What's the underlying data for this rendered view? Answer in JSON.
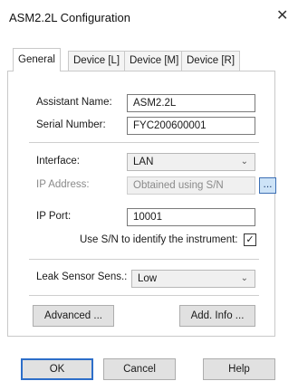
{
  "window": {
    "title": "ASM2.2L Configuration",
    "close_glyph": "✕"
  },
  "tabs": [
    "General",
    "Device [L]",
    "Device [M]",
    "Device [R]"
  ],
  "active_tab": "General",
  "fields": {
    "assistant_name_label": "Assistant Name:",
    "assistant_name_value": "ASM2.2L",
    "serial_number_label": "Serial Number:",
    "serial_number_value": "FYC200600001",
    "interface_label": "Interface:",
    "interface_value": "LAN",
    "ip_address_label": "IP Address:",
    "ip_address_value": "Obtained using S/N",
    "ip_browse_label": "...",
    "ip_port_label": "IP Port:",
    "ip_port_value": "10001",
    "use_sn_label": "Use S/N to identify the instrument:",
    "use_sn_checked": true,
    "use_sn_check_glyph": "✓",
    "leak_sensor_label": "Leak Sensor Sens.:",
    "leak_sensor_value": "Low"
  },
  "buttons": {
    "advanced": "Advanced ...",
    "add_info": "Add. Info ...",
    "ok": "OK",
    "cancel": "Cancel",
    "help": "Help"
  },
  "colors": {
    "accent": "#2d6ec9",
    "browse_bg": "#cde3f7",
    "disabled_text": "#8a8a8a"
  }
}
